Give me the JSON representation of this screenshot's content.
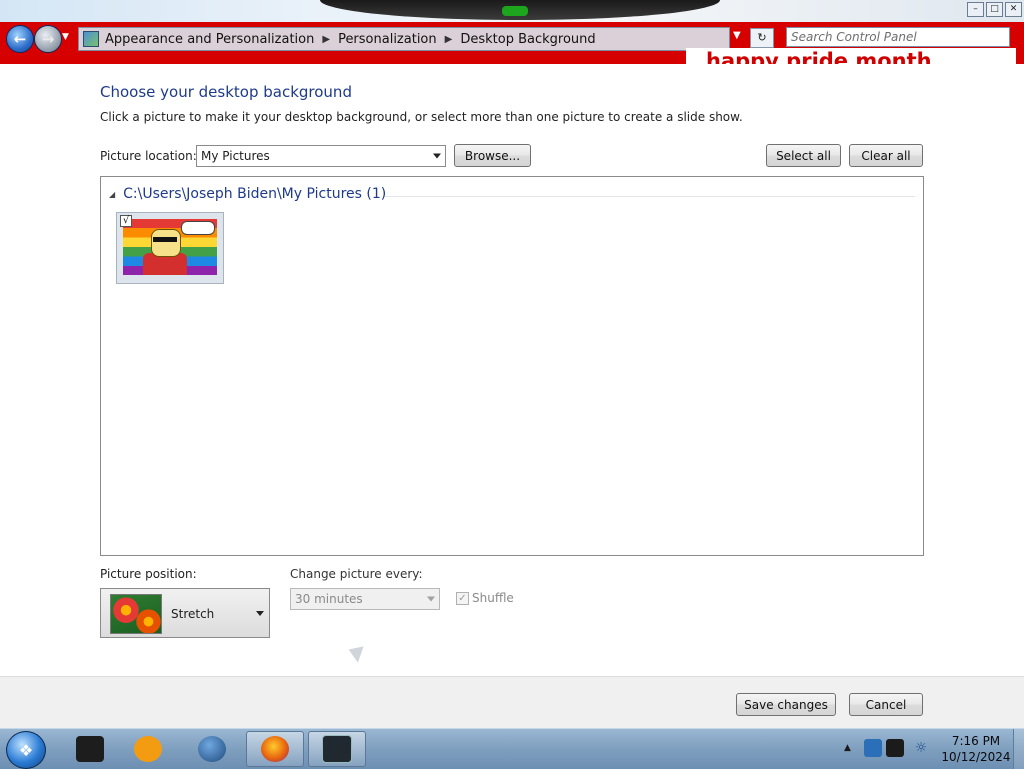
{
  "window": {
    "controls": [
      "–",
      "□",
      "✕"
    ],
    "recent_pages_icon": "chevron-down-icon"
  },
  "navigation": {
    "breadcrumbs": [
      {
        "label": "Appearance and Personalization"
      },
      {
        "label": "Personalization"
      },
      {
        "label": "Desktop Background"
      }
    ],
    "search_placeholder": "Search Control Panel"
  },
  "overlay": {
    "banner_text": "happy pride month"
  },
  "page": {
    "title": "Choose your desktop background",
    "description": "Click a picture to make it your desktop background, or select more than one picture to create a slide show.",
    "picture_location_label": "Picture location:",
    "picture_location_value": "My Pictures",
    "browse_label": "Browse...",
    "select_all_label": "Select all",
    "clear_all_label": "Clear all",
    "group_header": "C:\\Users\\Joseph Biden\\My Pictures (1)",
    "thumbnails": [
      {
        "checked": true,
        "check_mark": "√"
      }
    ],
    "picture_position_label": "Picture position:",
    "picture_position_value": "Stretch",
    "change_picture_label": "Change picture every:",
    "change_picture_value": "30 minutes",
    "shuffle_label": "Shuffle",
    "shuffle_checked": true
  },
  "footer": {
    "save_label": "Save changes",
    "cancel_label": "Cancel"
  },
  "taskbar": {
    "apps": [
      {
        "name": "media-center-icon",
        "color": "#1d1d1d"
      },
      {
        "name": "media-player-icon",
        "color": "#f39c12"
      },
      {
        "name": "globe-icon",
        "color": "#1f4a7d"
      },
      {
        "name": "firefox-icon",
        "color": "#e8650d"
      },
      {
        "name": "screen-app-icon",
        "color": "#202830"
      }
    ],
    "time": "7:16 PM",
    "date": "10/12/2024"
  },
  "colors": {
    "title_blue": "#1e3a8a",
    "chrome_red": "#d60000",
    "taskbar_blue": "#7f9fbf"
  }
}
